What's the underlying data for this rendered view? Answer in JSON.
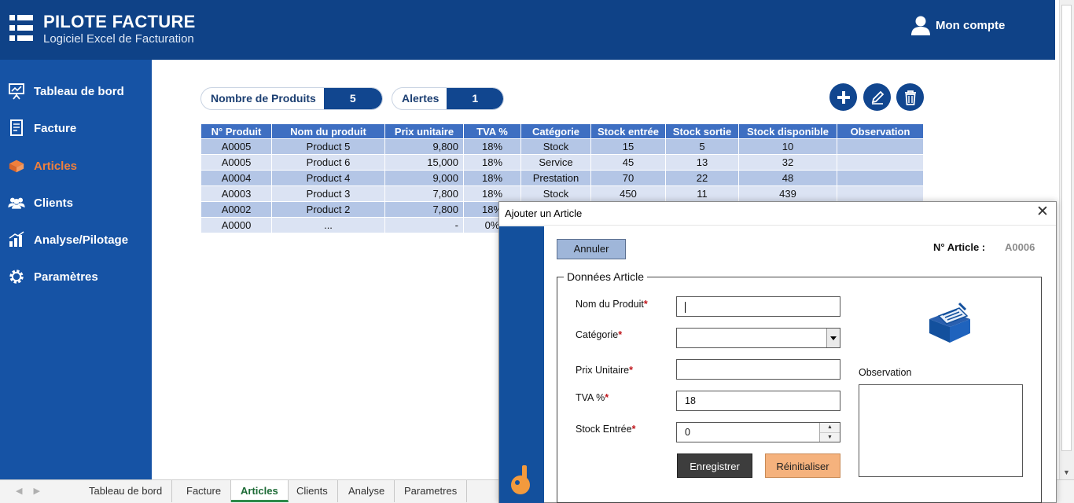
{
  "header": {
    "title": "PILOTE FACTURE",
    "subtitle": "Logiciel Excel de Facturation",
    "account_label": "Mon compte"
  },
  "sidebar": {
    "items": [
      {
        "label": "Tableau de bord",
        "icon": "presentation-board-icon"
      },
      {
        "label": "Facture",
        "icon": "invoice-icon"
      },
      {
        "label": "Articles",
        "icon": "boxes-icon",
        "active": true
      },
      {
        "label": "Clients",
        "icon": "users-icon"
      },
      {
        "label": "Analyse/Pilotage",
        "icon": "bar-chart-icon"
      },
      {
        "label": "Paramètres",
        "icon": "gear-icon"
      }
    ]
  },
  "counters": {
    "products_label": "Nombre de Produits",
    "products_value": "5",
    "alerts_label": "Alertes",
    "alerts_value": "1"
  },
  "actions": [
    "plus-icon",
    "pencil-icon",
    "trash-icon"
  ],
  "table": {
    "headers": [
      "N° Produit",
      "Nom du produit",
      "Prix unitaire",
      "TVA %",
      "Catégorie",
      "Stock entrée",
      "Stock sortie",
      "Stock disponible",
      "Observation"
    ],
    "rows": [
      [
        "A0005",
        "Product 5",
        "9,800",
        "18%",
        "Stock",
        "15",
        "5",
        "10",
        ""
      ],
      [
        "A0005",
        "Product 6",
        "15,000",
        "18%",
        "Service",
        "45",
        "13",
        "32",
        ""
      ],
      [
        "A0004",
        "Product 4",
        "9,000",
        "18%",
        "Prestation",
        "70",
        "22",
        "48",
        ""
      ],
      [
        "A0003",
        "Product 3",
        "7,800",
        "18%",
        "Stock",
        "450",
        "11",
        "439",
        ""
      ],
      [
        "A0002",
        "Product 2",
        "7,800",
        "18%",
        "",
        "",
        "",
        "",
        ""
      ],
      [
        "A0000",
        "...",
        "-",
        "0%",
        "",
        "",
        "",
        "",
        ""
      ]
    ]
  },
  "sheet_tabs": [
    "Tableau de bord",
    "Facture",
    "Articles",
    "Clients",
    "Analyse",
    "Parametres"
  ],
  "active_sheet": "Articles",
  "dialog": {
    "title": "Ajouter un Article",
    "close": "✕",
    "cancel_label": "Annuler",
    "article_no_label": "N° Article :",
    "article_no_value": "A0006",
    "section_title": "Données Article",
    "fields": {
      "name_label": "Nom du Produit",
      "name_value": "",
      "category_label": "Catégorie",
      "category_value": "",
      "price_label": "Prix Unitaire",
      "price_value": "",
      "vat_label": "TVA %",
      "vat_value": "18",
      "stock_label": "Stock Entrée",
      "stock_value": "0"
    },
    "required_mark": "*",
    "observation_label": "Observation",
    "save_label": "Enregistrer",
    "reset_label": "Réinitialiser"
  },
  "colors": {
    "header_bg": "#0f4287",
    "sidebar_bg": "#1653a5",
    "active_nav": "#f0803c",
    "table_header": "#3e6fc2",
    "save_button": "#3d3d3d",
    "reset_button": "#f5b27d"
  }
}
